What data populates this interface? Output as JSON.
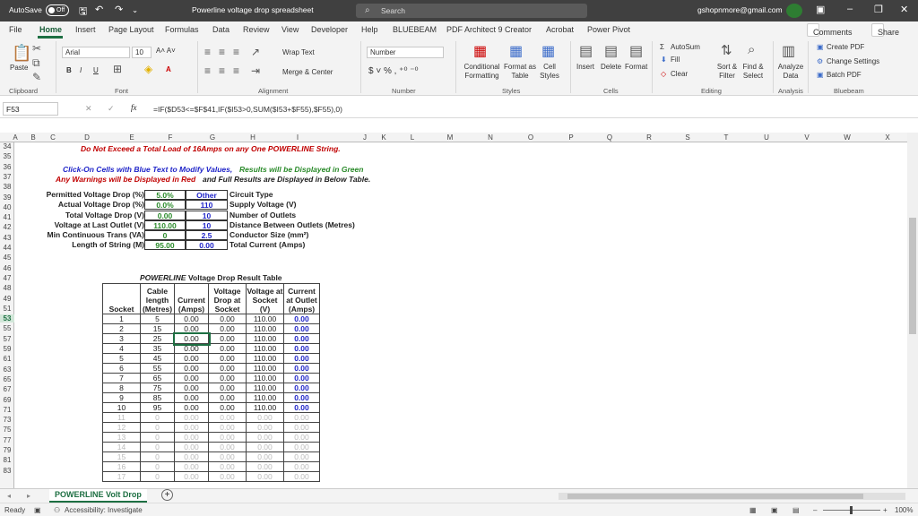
{
  "titlebar": {
    "autosave": "AutoSave",
    "autosave_state": "Off",
    "file": "Powerline voltage drop spreadsheet",
    "search": "Search",
    "account": "gshopnmore@gmail.com"
  },
  "menu": [
    "File",
    "Home",
    "Insert",
    "Page Layout",
    "Formulas",
    "Data",
    "Review",
    "View",
    "Developer",
    "Help",
    "BLUEBEAM",
    "PDF Architect 9 Creator",
    "Acrobat",
    "Power Pivot"
  ],
  "top_buttons": {
    "comments": "Comments",
    "share": "Share"
  },
  "ribbon": {
    "paste": "Paste",
    "font": "Arial",
    "size": "10",
    "wrap": "Wrap Text",
    "merge": "Merge & Center",
    "number_format": "Number",
    "cond": "Conditional Formatting",
    "format_table": "Format as Table",
    "cell_styles": "Cell Styles",
    "insert": "Insert",
    "delete": "Delete",
    "format": "Format",
    "autosum": "AutoSum",
    "fill": "Fill",
    "clear": "Clear",
    "sort": "Sort & Filter",
    "find": "Find & Select",
    "analyze": "Analyze Data",
    "create_pdf": "Create PDF",
    "change_settings": "Change Settings",
    "batch_pdf": "Batch PDF",
    "groups": [
      "Clipboard",
      "Font",
      "Alignment",
      "Number",
      "Styles",
      "Cells",
      "Editing",
      "Analysis",
      "Bluebeam"
    ]
  },
  "formula_bar": {
    "cell": "F53",
    "formula": "=IF($D53<=$F$41,IF($I53>0,SUM($I53+$F55),$F55),0)"
  },
  "columns": [
    "A",
    "B",
    "C",
    "D",
    "E",
    "F",
    "G",
    "H",
    "I",
    "J",
    "K",
    "L",
    "M",
    "N",
    "O",
    "P",
    "Q",
    "R",
    "S",
    "T",
    "U",
    "V",
    "W",
    "X"
  ],
  "rows": [
    "34",
    "35",
    "36",
    "37",
    "38",
    "39",
    "40",
    "41",
    "42",
    "43",
    "44",
    "45",
    "46",
    "47",
    "48",
    "49",
    "51",
    "53",
    "55",
    "57",
    "59",
    "61",
    "63",
    "65",
    "67",
    "69",
    "71",
    "73",
    "75",
    "77",
    "79",
    "81",
    "83"
  ],
  "sheet": {
    "warning1": "Do Not Exceed a Total Load of 16Amps on any One POWERLINE String.",
    "info1a": "Click-On Cells with Blue Text to Modify Values,",
    "info1b": "Results will be Displayed in Green",
    "info2a": "Any Warnings will be Displayed in Red",
    "info2b": "and Full Results are Displayed in Below Table.",
    "left_labels": [
      "Permitted Voltage Drop (%)",
      "Actual Voltage Drop (%)",
      "Total Voltage Drop (V)",
      "Voltage at Last Outlet (V)",
      "Min Continuous Trans (VA)",
      "Length of String (M)"
    ],
    "left_values": [
      "5.0%",
      "0.0%",
      "0.00",
      "110.00",
      "0",
      "95.00"
    ],
    "right_values": [
      "Other",
      "110",
      "10",
      "10",
      "2.5",
      "0.00"
    ],
    "right_labels": [
      "Circuit Type",
      "Supply Voltage (V)",
      "Number of Outlets",
      "Distance Between Outlets (Metres)",
      "Conductor Size (mm²)",
      "Total Current (Amps)"
    ],
    "table_title_a": "POWERLINE",
    "table_title_b": " Voltage Drop Result Table",
    "headers": [
      [
        "",
        "Socket"
      ],
      [
        "Cable length",
        "(Metres)"
      ],
      [
        "Current",
        "(Amps)"
      ],
      [
        "Voltage Drop at",
        "Socket"
      ],
      [
        "Voltage at Socket",
        "(V)"
      ],
      [
        "Current at Outlet",
        "(Amps)"
      ]
    ],
    "table_rows": [
      [
        "1",
        "5",
        "0.00",
        "0.00",
        "110.00",
        "0.00"
      ],
      [
        "2",
        "15",
        "0.00",
        "0.00",
        "110.00",
        "0.00"
      ],
      [
        "3",
        "25",
        "0.00",
        "0.00",
        "110.00",
        "0.00"
      ],
      [
        "4",
        "35",
        "0.00",
        "0.00",
        "110.00",
        "0.00"
      ],
      [
        "5",
        "45",
        "0.00",
        "0.00",
        "110.00",
        "0.00"
      ],
      [
        "6",
        "55",
        "0.00",
        "0.00",
        "110.00",
        "0.00"
      ],
      [
        "7",
        "65",
        "0.00",
        "0.00",
        "110.00",
        "0.00"
      ],
      [
        "8",
        "75",
        "0.00",
        "0.00",
        "110.00",
        "0.00"
      ],
      [
        "9",
        "85",
        "0.00",
        "0.00",
        "110.00",
        "0.00"
      ],
      [
        "10",
        "95",
        "0.00",
        "0.00",
        "110.00",
        "0.00"
      ],
      [
        "11",
        "0",
        "0.00",
        "0.00",
        "0.00",
        "0.00"
      ],
      [
        "12",
        "0",
        "0.00",
        "0.00",
        "0.00",
        "0.00"
      ],
      [
        "13",
        "0",
        "0.00",
        "0.00",
        "0.00",
        "0.00"
      ],
      [
        "14",
        "0",
        "0.00",
        "0.00",
        "0.00",
        "0.00"
      ],
      [
        "15",
        "0",
        "0.00",
        "0.00",
        "0.00",
        "0.00"
      ],
      [
        "16",
        "0",
        "0.00",
        "0.00",
        "0.00",
        "0.00"
      ],
      [
        "17",
        "0",
        "0.00",
        "0.00",
        "0.00",
        "0.00"
      ]
    ]
  },
  "tabs": {
    "sheet": "POWERLINE Volt Drop",
    "add": "+"
  },
  "status": {
    "ready": "Ready",
    "accessibility": "Accessibility: Investigate",
    "zoom": "100%"
  },
  "colors": {
    "title_bg": "#404040",
    "excel_green": "#1d6f42",
    "blue_text": "#1f24c8",
    "green_text": "#2a8a2a",
    "red_text": "#c00000"
  }
}
